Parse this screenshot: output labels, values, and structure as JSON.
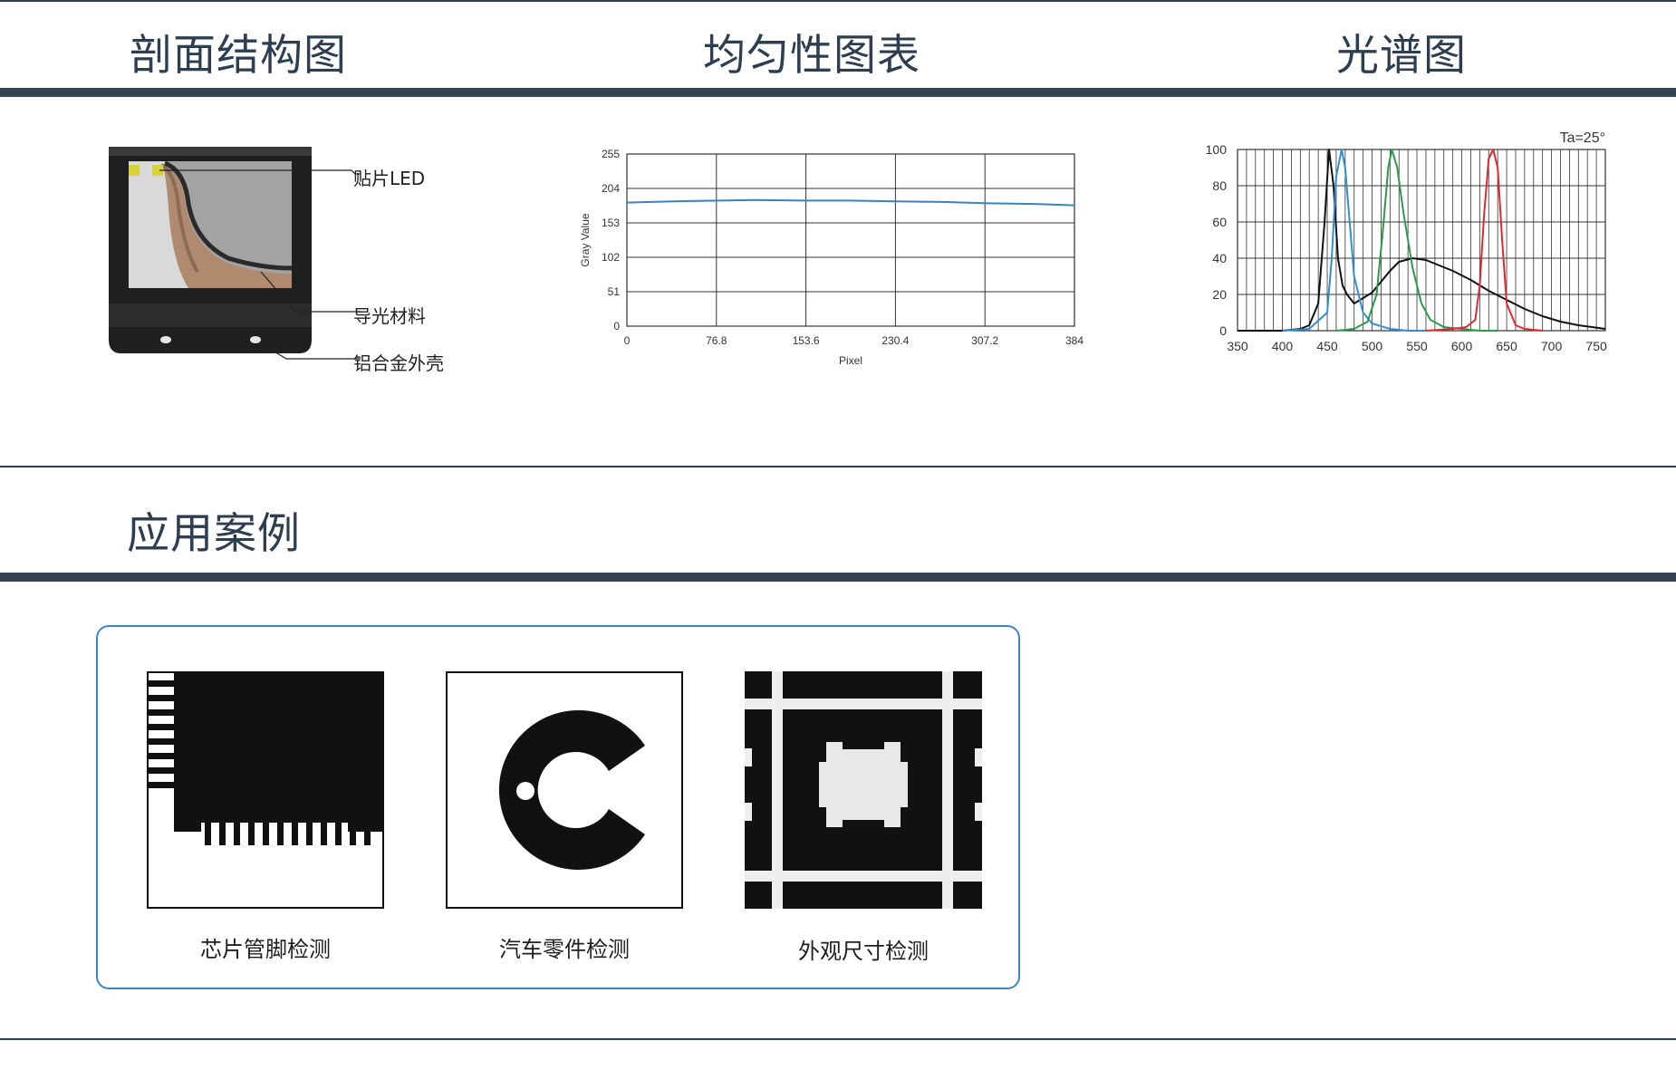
{
  "sections": {
    "structure_title": "剖面结构图",
    "uniformity_title": "均匀性图表",
    "spectrum_title": "光谱图",
    "cases_title": "应用案例"
  },
  "structure": {
    "callouts": [
      "贴片LED",
      "导光材料",
      "铝合金外壳"
    ]
  },
  "chart_data": [
    {
      "type": "line",
      "title": "",
      "xlabel": "Pixel",
      "ylabel": "Gray Value",
      "xlim": [
        0,
        384
      ],
      "ylim": [
        0,
        255
      ],
      "x_ticks": [
        "0",
        "76.8",
        "153.6",
        "230.4",
        "307.2",
        "384"
      ],
      "y_ticks": [
        "0",
        "51",
        "102",
        "153",
        "204",
        "255"
      ],
      "grid": true,
      "series": [
        {
          "color": "#3b82c4",
          "x": [
            0,
            40,
            80,
            110,
            150,
            190,
            230,
            270,
            310,
            350,
            384
          ],
          "y": [
            183,
            185,
            186,
            187,
            186,
            186,
            185,
            184,
            182,
            181,
            179
          ]
        }
      ]
    },
    {
      "type": "line",
      "title": "",
      "annotation": "Ta=25°",
      "xlabel": "",
      "ylabel": "",
      "xlim": [
        350,
        760
      ],
      "ylim": [
        0,
        100
      ],
      "x_ticks": [
        "350",
        "400",
        "450",
        "500",
        "550",
        "600",
        "650",
        "700",
        "750"
      ],
      "y_ticks": [
        "0",
        "20",
        "40",
        "60",
        "80",
        "100"
      ],
      "grid": true,
      "series": [
        {
          "color": "#111111",
          "x": [
            350,
            380,
            400,
            420,
            430,
            440,
            447,
            452,
            457,
            462,
            467,
            472,
            480,
            490,
            500,
            510,
            520,
            530,
            545,
            560,
            575,
            590,
            610,
            630,
            650,
            670,
            690,
            710,
            730,
            760
          ],
          "y": [
            0,
            0,
            0,
            1,
            3,
            15,
            60,
            100,
            80,
            40,
            25,
            20,
            15,
            18,
            21,
            27,
            33,
            38,
            40,
            39,
            36,
            33,
            28,
            22,
            17,
            12,
            8,
            5,
            3,
            1
          ]
        },
        {
          "color": "#2f8fd0",
          "x": [
            400,
            430,
            450,
            455,
            460,
            466,
            470,
            475,
            480,
            490,
            500,
            520,
            540,
            560
          ],
          "y": [
            0,
            1,
            10,
            40,
            85,
            100,
            90,
            60,
            30,
            10,
            4,
            1,
            0,
            0
          ]
        },
        {
          "color": "#2a9b4a",
          "x": [
            460,
            480,
            495,
            505,
            512,
            518,
            522,
            528,
            535,
            545,
            555,
            565,
            580,
            600,
            620,
            640
          ],
          "y": [
            0,
            1,
            5,
            20,
            55,
            90,
            100,
            90,
            65,
            35,
            15,
            6,
            2,
            1,
            0,
            0
          ]
        },
        {
          "color": "#e0282e",
          "x": [
            560,
            590,
            605,
            615,
            620,
            625,
            630,
            635,
            640,
            645,
            650,
            660,
            670,
            690
          ],
          "y": [
            0,
            1,
            2,
            6,
            25,
            65,
            95,
            100,
            90,
            50,
            15,
            3,
            1,
            0
          ]
        }
      ]
    }
  ],
  "cases": [
    {
      "label": "芯片管脚检测"
    },
    {
      "label": "汽车零件检测"
    },
    {
      "label": "外观尺寸检测"
    }
  ]
}
